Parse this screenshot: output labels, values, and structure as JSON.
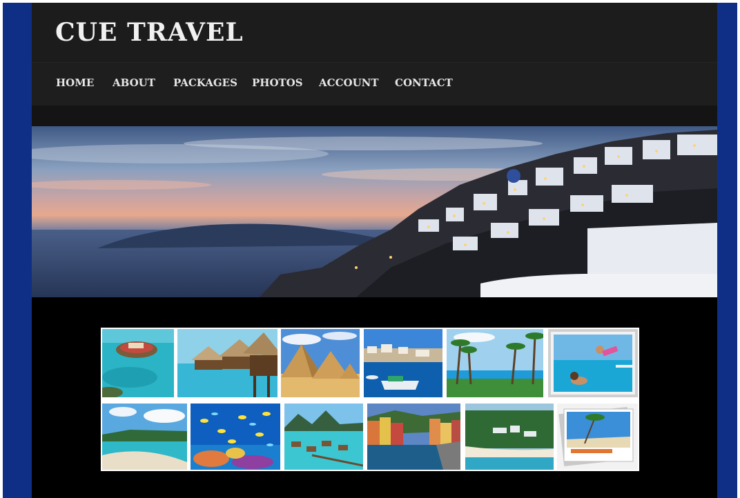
{
  "site": {
    "title": "CUE TRAVEL"
  },
  "nav": {
    "items": [
      {
        "label": "HOME"
      },
      {
        "label": "ABOUT"
      },
      {
        "label": "PACKAGES"
      },
      {
        "label": "PHOTOS"
      },
      {
        "label": "ACCOUNT"
      },
      {
        "label": "CONTACT"
      }
    ]
  },
  "hero": {
    "image": "santorini-sunset-photo"
  },
  "gallery": {
    "row1": [
      {
        "image": "island-resort-photo"
      },
      {
        "image": "overwater-bungalows-photo"
      },
      {
        "image": "pyramids-photo"
      },
      {
        "image": "harbor-boat-photo"
      },
      {
        "image": "palm-beach-photo"
      },
      {
        "image": "pool-family-photo"
      }
    ],
    "row2": [
      {
        "image": "beach-cove-photo"
      },
      {
        "image": "coral-reef-fish-photo"
      },
      {
        "image": "bora-bora-bungalows-photo"
      },
      {
        "image": "italian-harbor-town-photo"
      },
      {
        "image": "coastal-resort-aerial-photo"
      },
      {
        "image": "travel-postcards-photo"
      }
    ]
  },
  "colors": {
    "frame": "#0f2f86",
    "header": "#1c1c1c",
    "nav": "#1e1e1e",
    "page": "#000000",
    "title": "#f1f1f1"
  }
}
